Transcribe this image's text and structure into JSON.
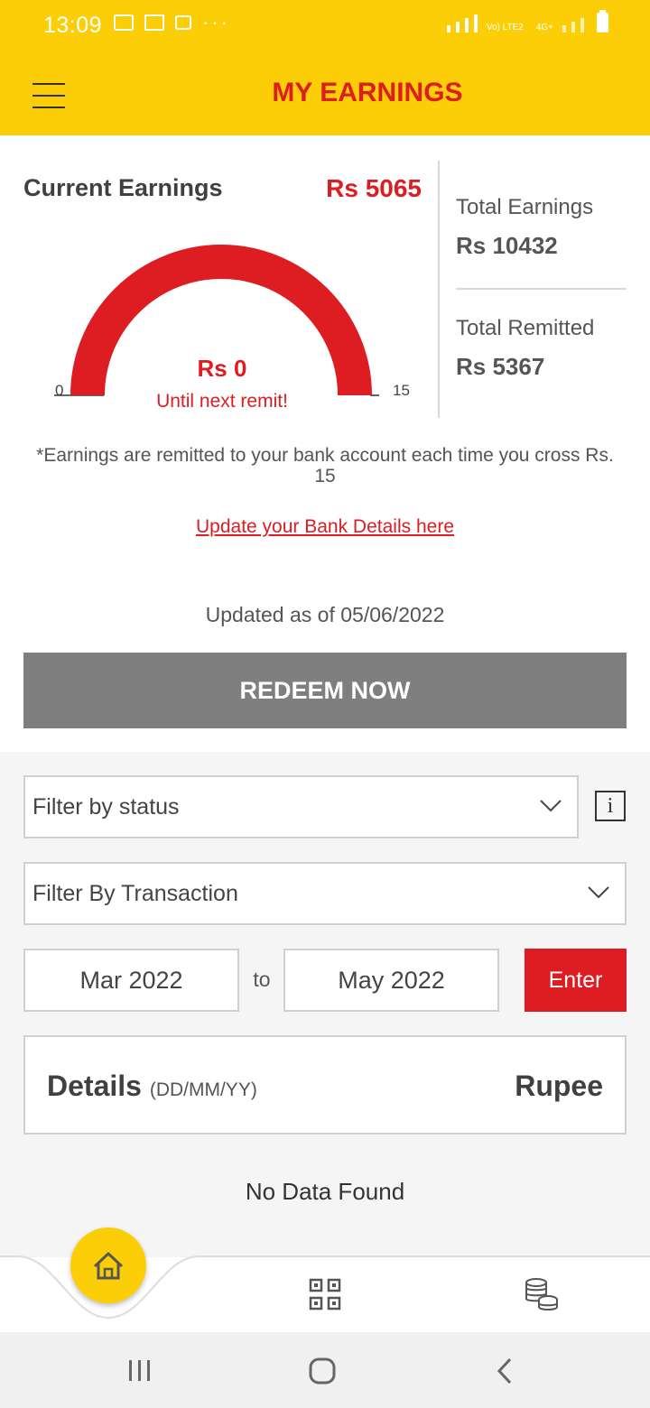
{
  "status_bar": {
    "time": "13:09",
    "network_label": "Vo) LTE2",
    "network_type": "4G+"
  },
  "header": {
    "title": "MY EARNINGS",
    "background_color": "#fbce07",
    "title_color": "#dd1d21"
  },
  "earnings": {
    "current_label": "Current Earnings",
    "current_value": "Rs 5065",
    "total_earnings_label": "Total Earnings",
    "total_earnings_value": "Rs 10432",
    "total_remitted_label": "Total Remitted",
    "total_remitted_value": "Rs 5367"
  },
  "gauge": {
    "min_label": "0",
    "max_label": "15",
    "value_label": "Rs 0",
    "sub_label": "Until next remit!",
    "fill_fraction": 1.0,
    "color": "#dd1d21"
  },
  "note": "*Earnings are remitted to your bank account each time you cross Rs. 15",
  "bank_link": "Update your Bank Details here",
  "updated": "Updated as of 05/06/2022",
  "redeem_label": "REDEEM NOW",
  "filters": {
    "status_placeholder": "Filter by status",
    "info_label": "i",
    "transaction_placeholder": "Filter By Transaction",
    "from_date": "Mar 2022",
    "to_label": "to",
    "to_date": "May 2022",
    "enter_label": "Enter"
  },
  "details": {
    "title": "Details",
    "title_sub": "(DD/MM/YY)",
    "amount_header": "Rupee",
    "empty_text": "No Data Found"
  },
  "bottom_nav": {
    "items": [
      "home-icon",
      "qr-code-icon",
      "coins-icon"
    ],
    "active": "home-icon"
  },
  "android_nav": {
    "items": [
      "recent-apps-icon",
      "home-circle-icon",
      "back-icon"
    ]
  }
}
